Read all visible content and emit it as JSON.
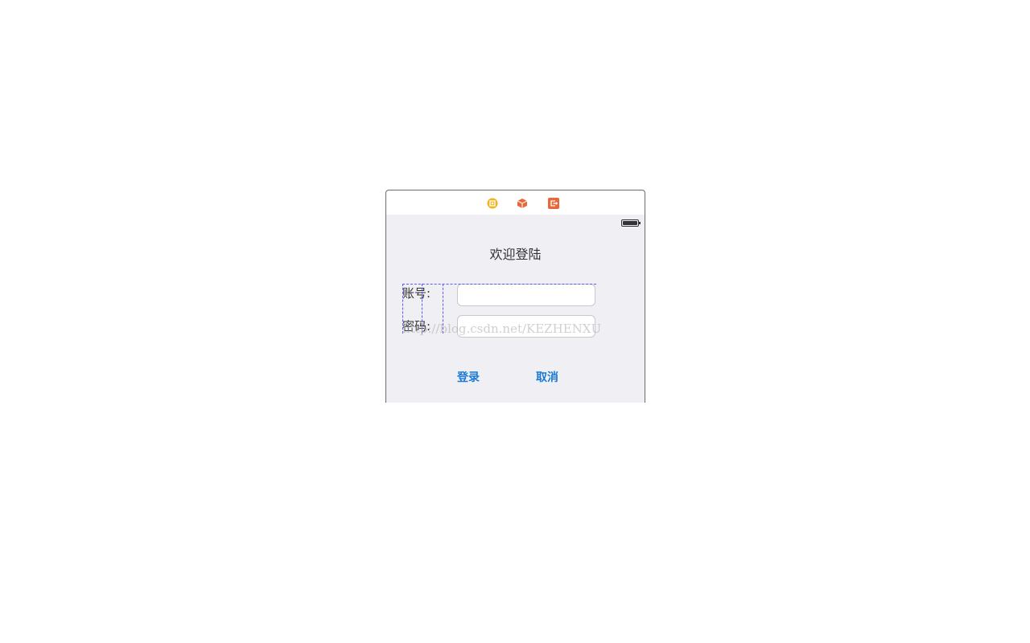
{
  "scene_dock": {
    "icons": [
      "view-controller-icon",
      "first-responder-icon",
      "exit-icon"
    ]
  },
  "status_bar": {
    "battery": "full"
  },
  "screen": {
    "title": "欢迎登陆",
    "account_label": "账号:",
    "account_value": "",
    "password_label": "密码:",
    "password_value": "",
    "login_button": "登录",
    "cancel_button": "取消"
  },
  "watermark": "http://blog.csdn.net/KEZHENXU",
  "colors": {
    "accent": "#1a7ad4",
    "background": "#efeff4",
    "dock_yellow": "#f0b41e",
    "dock_orange": "#e8683a",
    "guide": "#5a5aff"
  }
}
